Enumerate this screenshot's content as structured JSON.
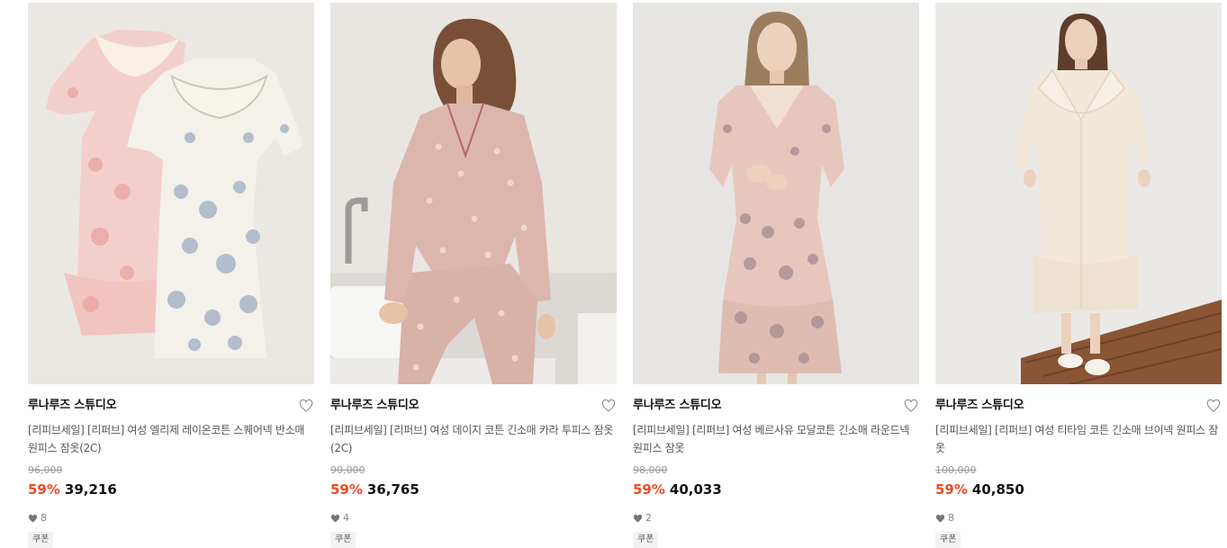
{
  "products": [
    {
      "brand": "루나루즈 스튜디오",
      "title": "[리피브세일] [리퍼브] 여성 엘리제 레이온코튼 스퀘어넥 반소매 원피스 잠옷(2C)",
      "original_price": "96,000",
      "discount": "59%",
      "sale_price": "39,216",
      "likes": "8",
      "tag": "쿠폰",
      "image": "two-short-sleeve-floral-dresses",
      "bg_color": "#ebe8e3"
    },
    {
      "brand": "루나루즈 스튜디오",
      "title": "[리피브세일] [리퍼브] 여성 데이지 코튼 긴소매 카라 투피스 잠옷(2C)",
      "original_price": "90,000",
      "discount": "59%",
      "sale_price": "36,765",
      "likes": "4",
      "tag": "쿠폰",
      "image": "model-pink-dot-pajama-set",
      "bg_color": "#e9e6e2"
    },
    {
      "brand": "루나루즈 스튜디오",
      "title": "[리피브세일] [리퍼브] 여성 베르사유 모달코튼 긴소매 라운드넥 원피스 잠옷",
      "original_price": "98,000",
      "discount": "59%",
      "sale_price": "40,033",
      "likes": "2",
      "tag": "쿠폰",
      "image": "model-pink-floral-long-dress",
      "bg_color": "#e7e5e2"
    },
    {
      "brand": "루나루즈 스튜디오",
      "title": "[리피브세일] [리퍼브] 여성 티타임 코튼 긴소매 브이넥 원피스 잠옷",
      "original_price": "100,000",
      "discount": "59%",
      "sale_price": "40,850",
      "likes": "8",
      "tag": "쿠폰",
      "image": "model-cream-ruffle-long-dress",
      "bg_color": "#ebe9e6"
    }
  ],
  "icons": {
    "wishlist": "heart-outline-icon",
    "likes": "heart-filled-icon"
  },
  "colors": {
    "discount": "#ef4a23",
    "original_price": "#9a9a9a",
    "tag_bg": "#f2f2f2"
  }
}
